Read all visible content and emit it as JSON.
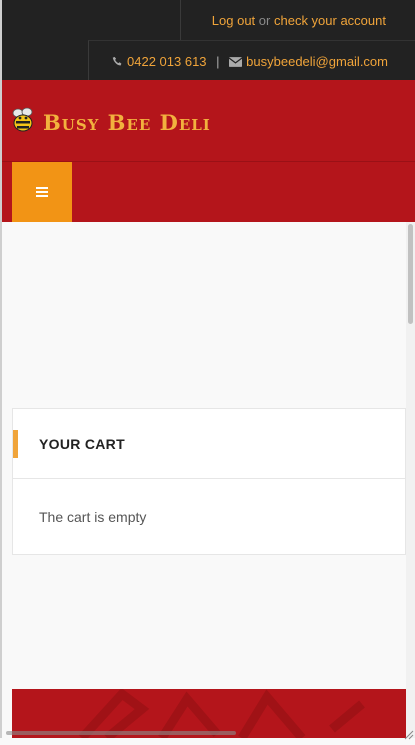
{
  "account": {
    "logout_label": "Log out",
    "or_text": "or",
    "check_account_label": "check your account"
  },
  "contact": {
    "phone_icon": "phone-icon",
    "phone": "0422 013 613",
    "separator": "|",
    "email_icon": "envelope-icon",
    "email": "busybeedeli@gmail.com"
  },
  "brand": {
    "name": "Busy Bee Deli",
    "logo_icon": "bee-icon"
  },
  "menu": {
    "icon": "hamburger-menu-icon"
  },
  "cart": {
    "title": "YOUR CART",
    "empty_text": "The cart is empty"
  },
  "colors": {
    "brand_red": "#b4151b",
    "accent_orange": "#f29415",
    "link_orange": "#f0a43a",
    "topbar_dark": "#222222"
  }
}
